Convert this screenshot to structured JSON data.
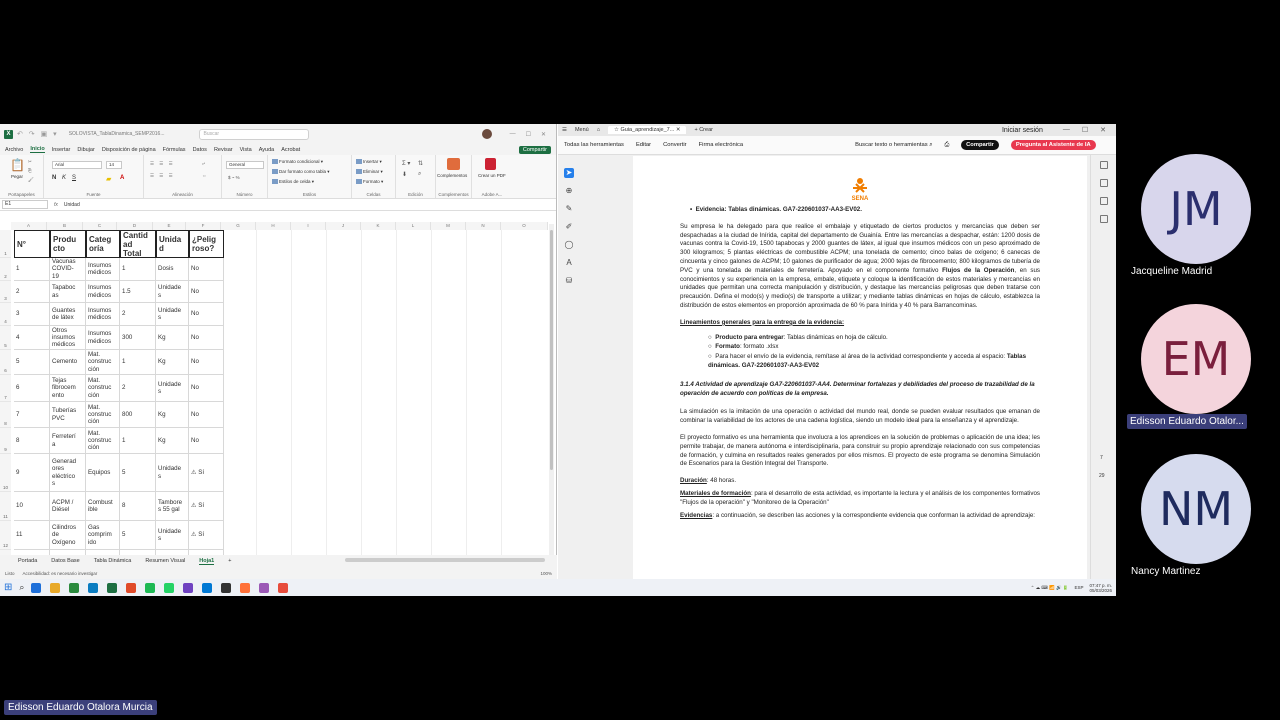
{
  "excel": {
    "filename": "SOLOVISTA_TablaDinamica_SEMP2016...",
    "search_placeholder": "Buscar",
    "menu": [
      "Archivo",
      "Inicio",
      "Insertar",
      "Dibujar",
      "Disposición de página",
      "Fórmulas",
      "Datos",
      "Revisar",
      "Vista",
      "Ayuda",
      "Acrobat"
    ],
    "share": "Compartir",
    "ribbon": {
      "paste": "Pegar",
      "font_name": "Arial",
      "font_size": "14",
      "number_format": "General",
      "cond_format": "Formato condicional",
      "table_format": "Dar formato como tabla",
      "cell_styles": "Estilos de celda",
      "insert": "Insertar",
      "delete": "Eliminar",
      "format": "Formato",
      "addins": "Complementos",
      "create_pdf": "Crear un PDF",
      "groups": [
        "Portapapeles",
        "Fuente",
        "Alineación",
        "Número",
        "Estilos",
        "Celdas",
        "Edición",
        "Complementos",
        "Adobe A..."
      ]
    },
    "namebox": "E1",
    "formula": "Unidad",
    "columns": [
      "A",
      "B",
      "C",
      "D",
      "E",
      "F",
      "G",
      "H",
      "I",
      "J",
      "K",
      "L",
      "M",
      "N",
      "O"
    ],
    "headers": [
      "N°",
      "Producto",
      "Categoría",
      "Cantidad Total",
      "Unidad",
      "¿Peligroso?"
    ],
    "header_display": [
      "N°",
      "Produ\ncto",
      "Categ\noría",
      "Cantid\nad\nTotal",
      "Unida\nd",
      "¿Pelig\nroso?"
    ],
    "rows": [
      {
        "n": "1",
        "producto": "Vacunas COVID-19",
        "categoria": "Insumos médicos",
        "cantidad": "1",
        "unidad": "Dosis",
        "peligroso": "No"
      },
      {
        "n": "2",
        "producto": "Tapabocas",
        "categoria": "Insumos médicos",
        "cantidad": "1.5",
        "unidad": "Unidades",
        "peligroso": "No"
      },
      {
        "n": "3",
        "producto": "Guantes de látex",
        "categoria": "Insumos médicos",
        "cantidad": "2",
        "unidad": "Unidades",
        "peligroso": "No"
      },
      {
        "n": "4",
        "producto": "Otros insumos médicos",
        "categoria": "Insumos médicos",
        "cantidad": "300",
        "unidad": "Kg",
        "peligroso": "No"
      },
      {
        "n": "5",
        "producto": "Cemento",
        "categoria": "Mat. construcción",
        "cantidad": "1",
        "unidad": "Kg",
        "peligroso": "No"
      },
      {
        "n": "6",
        "producto": "Tejas fibrocemento",
        "categoria": "Mat. construcción",
        "cantidad": "2",
        "unidad": "Unidades",
        "peligroso": "No"
      },
      {
        "n": "7",
        "producto": "Tuberías PVC",
        "categoria": "Mat. construcción",
        "cantidad": "800",
        "unidad": "Kg",
        "peligroso": "No"
      },
      {
        "n": "8",
        "producto": "Ferretería",
        "categoria": "Mat. construcción",
        "cantidad": "1",
        "unidad": "Kg",
        "peligroso": "No"
      },
      {
        "n": "9",
        "producto": "Generadores eléctricos",
        "categoria": "Equipos",
        "cantidad": "5",
        "unidad": "Unidades",
        "peligroso": "⚠ Sí"
      },
      {
        "n": "10",
        "producto": "ACPM / Diésel",
        "categoria": "Combustible",
        "cantidad": "8",
        "unidad": "Tambores 55 gal",
        "peligroso": "⚠ Sí"
      },
      {
        "n": "11",
        "producto": "Cilindros de Oxígeno",
        "categoria": "Gas comprimido",
        "cantidad": "5",
        "unidad": "Unidades",
        "peligroso": "⚠ Sí"
      },
      {
        "n": "",
        "producto": "Purificad",
        "categoria": "Químico",
        "cantidad": "",
        "unidad": "",
        "peligroso": ""
      }
    ],
    "rows_display": [
      [
        "1",
        "Vacunas\nCOVID-\n19",
        "Insumos\nmédicos",
        "1",
        "Dosis",
        "No"
      ],
      [
        "2",
        "Tapaboc\nas",
        "Insumos\nmédicos",
        "1.5",
        "Unidade\ns",
        "No"
      ],
      [
        "3",
        "Guantes\nde látex",
        "Insumos\nmédicos",
        "2",
        "Unidade\ns",
        "No"
      ],
      [
        "4",
        "Otros\ninsumos\nmédicos",
        "Insumos\nmédicos",
        "300",
        "Kg",
        "No"
      ],
      [
        "5",
        "Cemento",
        "Mat.\nconstruc\nción",
        "1",
        "Kg",
        "No"
      ],
      [
        "6",
        "Tejas\nfibrocem\nento",
        "Mat.\nconstruc\nción",
        "2",
        "Unidade\ns",
        "No"
      ],
      [
        "7",
        "Tuberías\nPVC",
        "Mat.\nconstruc\nción",
        "800",
        "Kg",
        "No"
      ],
      [
        "8",
        "Ferreterí\na",
        "Mat.\nconstruc\nción",
        "1",
        "Kg",
        "No"
      ],
      [
        "9",
        "Generad\nores\neléctrico\ns",
        "Equipos",
        "5",
        "Unidade\ns",
        "⚠ Sí"
      ],
      [
        "10",
        "ACPM /\nDiésel",
        "Combust\nible",
        "8",
        "Tambore\ns 55 gal",
        "⚠ Sí"
      ],
      [
        "11",
        "Cilindros\nde\nOxígeno",
        "Gas\ncomprim\nido",
        "5",
        "Unidade\ns",
        "⚠ Sí"
      ],
      [
        "",
        "Purificad",
        "Químico",
        "",
        "",
        ""
      ]
    ],
    "sheets": [
      "Portada",
      "Datos Base",
      "Tabla Dinámica",
      "Resumen Visual",
      "Hoja1"
    ],
    "active_sheet": "Hoja1",
    "status_left": "Listo",
    "status_access": "Accesibilidad: es necesario investigar",
    "zoom": "100%"
  },
  "acrobat": {
    "menu": "Menú",
    "tab_title": "Guia_aprendizaje_7...",
    "new_tab": "+ Crear",
    "signin": "Iniciar sesión",
    "tools": [
      "Todas las herramientas",
      "Editar",
      "Convertir",
      "Firma electrónica"
    ],
    "search": "Buscar texto o herramientas",
    "share": "Compartir",
    "ai": "Pregunta al Asistente de IA",
    "page_nums": [
      "7",
      "29"
    ],
    "doc": {
      "bullet1": "Evidencia: Tablas dinámicas. GA7-220601037-AA3-EV02.",
      "para1": "Su empresa le ha delegado para que realice el embalaje y etiquetado de ciertos productos y mercancías que deben ser despachadas a la ciudad de Inírida, capital del departamento de Guainía. Entre las mercancías a despachar, están: 1200 dosis de vacunas contra la Covid-19, 1500 tapabocas y 2000 guantes de látex, al igual que insumos médicos con un peso aproximado de 300 kilogramos; 5 plantas eléctricas de combustible ACPM; una tonelada de cemento; cinco balas de oxígeno; 6 canecas de cincuenta y cinco galones de ACPM; 10 galones de purificador de agua; 2000 tejas de fibrocemento; 800 kilogramos de tubería de PVC y una tonelada de materiales de ferretería. Apoyado en el componente formativo",
      "para1_bold": "Flujos de la Operación",
      "para1_end": ", en sus conocimientos y su experiencia en la empresa, embale, etiquete y coloque la identificación de estos materiales y mercancías en unidades que permitan una correcta manipulación y distribución, y destaque las mercancías peligrosas que deben tratarse con precaución. Defina el modo(s) y medio(s) de transporte a utilizar; y mediante tablas dinámicas en hojas de cálculo, establezca la distribución de estos elementos en proporción aproximada de 60 % para Inírida y 40 % para Barrancominas.",
      "heading1": "Lineamientos generales para la entrega de la evidencia:",
      "sub1_label": "Producto para entregar",
      "sub1_text": ": Tablas dinámicas en hoja de cálculo.",
      "sub2_label": "Formato",
      "sub2_text": ": formato .xlsx",
      "sub3_text": "Para hacer el envío de la evidencia, remítase al área de la actividad correspondiente y acceda al espacio:",
      "sub3_bold": "Tablas dinámicas. GA7-220601037-AA3-EV02",
      "activity": "3.1.4 Actividad de aprendizaje GA7-220601037-AA4. Determinar fortalezas y debilidades del proceso de trazabilidad de la operación de acuerdo con políticas de la empresa.",
      "para2": "La simulación es la imitación de una operación o actividad del mundo real, donde se pueden evaluar resultados que emanan de combinar la variabilidad de los actores de una cadena logística, siendo un modelo ideal para la enseñanza y el aprendizaje.",
      "para3": "El proyecto formativo es una herramienta que involucra a los aprendices en la solución de problemas o aplicación de una idea; les permite trabajar, de manera autónoma e interdisciplinaria, para construir su propio aprendizaje relacionado con sus competencias de formación, y culmina en resultados reales generados por ellos mismos. El proyecto de este programa se denomina Simulación de Escenarios para la Gestión Integral del Transporte.",
      "duration_label": "Duración",
      "duration_text": ": 48 horas.",
      "materials_label": "Materiales de formación",
      "materials_text": ": para el desarrollo de esta actividad, es importante la lectura y el análisis de los componentes formativos \"Flujos de la operación\" y \"Monitoreo de la Operación\"",
      "evidence_label": "Evidencias",
      "evidence_text": ": a continuación, se describen las acciones y la correspondiente evidencia que conforman la actividad de aprendizaje:",
      "logo_text": "SENA"
    }
  },
  "taskbar": {
    "language": "ESP",
    "time": "07:47 p. m.",
    "date": "05/03/2026",
    "icon_colors": [
      "#1e6fd9",
      "#e8a92a",
      "#2b8a3e",
      "#0a7cc1",
      "#1d6f42",
      "#e04b2a",
      "#1db954",
      "#25d366",
      "#6f42c1",
      "#0078d4",
      "#333333",
      "#ff7139",
      "#9b59b6",
      "#e74c3c"
    ]
  },
  "participants": [
    {
      "initials": "JM",
      "name": "Jacqueline Madrid",
      "bg": "#d8d6ec",
      "fg": "#2b2f6e"
    },
    {
      "initials": "EM",
      "name": "Edisson Eduardo Otalor...",
      "bg": "#f4d4dc",
      "fg": "#7a1f3d"
    },
    {
      "initials": "NM",
      "name": "Nancy Martinez",
      "bg": "#d6dbee",
      "fg": "#1f2b5e"
    }
  ],
  "self_name": "Edisson Eduardo Otalora Murcia"
}
